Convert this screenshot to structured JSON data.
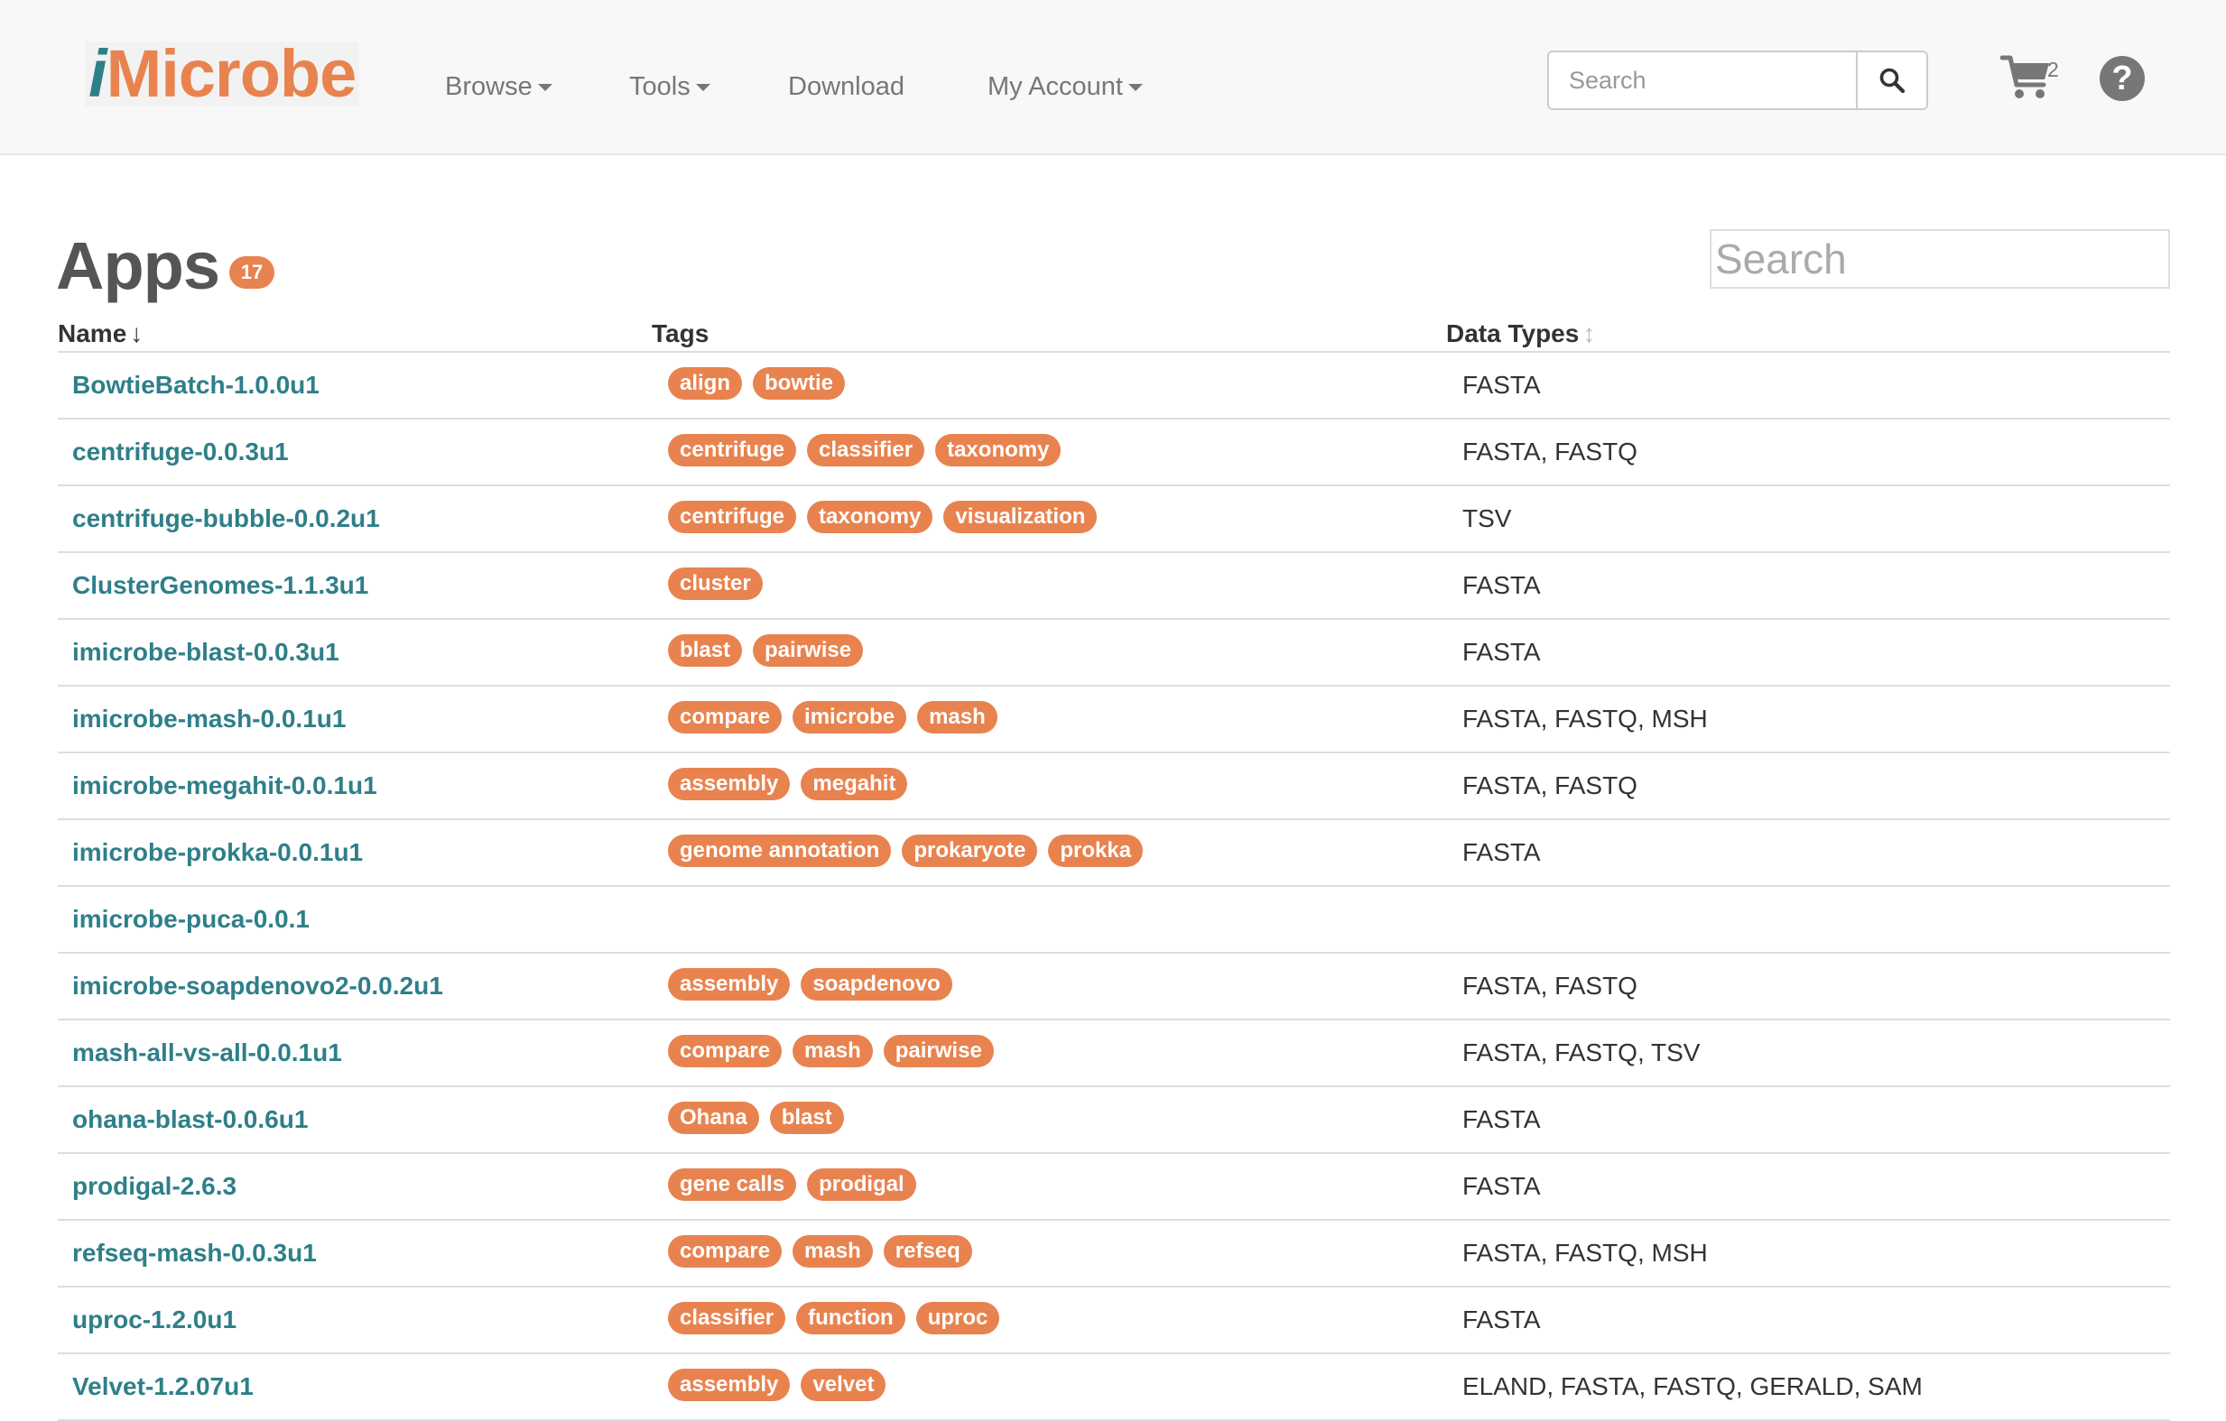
{
  "brand": {
    "logo_prefix": "i",
    "logo_rest": "Microbe"
  },
  "nav": {
    "browse": "Browse",
    "tools": "Tools",
    "download": "Download",
    "my_account": "My Account",
    "search_placeholder": "Search",
    "cart_count": "2",
    "help": "?"
  },
  "page": {
    "title": "Apps",
    "count": "17",
    "search_placeholder": "Search"
  },
  "table": {
    "headers": {
      "name": "Name",
      "tags": "Tags",
      "data_types": "Data Types"
    },
    "name_sort_indicator": "↓",
    "data_types_sort_indicator": "↕",
    "rows": [
      {
        "name": "BowtieBatch-1.0.0u1",
        "tags": [
          "align",
          "bowtie"
        ],
        "data_types": "FASTA"
      },
      {
        "name": "centrifuge-0.0.3u1",
        "tags": [
          "centrifuge",
          "classifier",
          "taxonomy"
        ],
        "data_types": "FASTA, FASTQ"
      },
      {
        "name": "centrifuge-bubble-0.0.2u1",
        "tags": [
          "centrifuge",
          "taxonomy",
          "visualization"
        ],
        "data_types": "TSV"
      },
      {
        "name": "ClusterGenomes-1.1.3u1",
        "tags": [
          "cluster"
        ],
        "data_types": "FASTA"
      },
      {
        "name": "imicrobe-blast-0.0.3u1",
        "tags": [
          "blast",
          "pairwise"
        ],
        "data_types": "FASTA"
      },
      {
        "name": "imicrobe-mash-0.0.1u1",
        "tags": [
          "compare",
          "imicrobe",
          "mash"
        ],
        "data_types": "FASTA, FASTQ, MSH"
      },
      {
        "name": "imicrobe-megahit-0.0.1u1",
        "tags": [
          "assembly",
          "megahit"
        ],
        "data_types": "FASTA, FASTQ"
      },
      {
        "name": "imicrobe-prokka-0.0.1u1",
        "tags": [
          "genome annotation",
          "prokaryote",
          "prokka"
        ],
        "data_types": "FASTA"
      },
      {
        "name": "imicrobe-puca-0.0.1",
        "tags": [],
        "data_types": ""
      },
      {
        "name": "imicrobe-soapdenovo2-0.0.2u1",
        "tags": [
          "assembly",
          "soapdenovo"
        ],
        "data_types": "FASTA, FASTQ"
      },
      {
        "name": "mash-all-vs-all-0.0.1u1",
        "tags": [
          "compare",
          "mash",
          "pairwise"
        ],
        "data_types": "FASTA, FASTQ, TSV"
      },
      {
        "name": "ohana-blast-0.0.6u1",
        "tags": [
          "Ohana",
          "blast"
        ],
        "data_types": "FASTA"
      },
      {
        "name": "prodigal-2.6.3",
        "tags": [
          "gene calls",
          "prodigal"
        ],
        "data_types": "FASTA"
      },
      {
        "name": "refseq-mash-0.0.3u1",
        "tags": [
          "compare",
          "mash",
          "refseq"
        ],
        "data_types": "FASTA, FASTQ, MSH"
      },
      {
        "name": "uproc-1.2.0u1",
        "tags": [
          "classifier",
          "function",
          "uproc"
        ],
        "data_types": "FASTA"
      },
      {
        "name": "Velvet-1.2.07u1",
        "tags": [
          "assembly",
          "velvet"
        ],
        "data_types": "ELAND, FASTA, FASTQ, GERALD, SAM"
      }
    ]
  },
  "icons": {
    "search": "search-icon",
    "cart": "cart-icon",
    "help": "help-icon"
  },
  "colors": {
    "accent": "#e8834f",
    "link": "#2e7f88",
    "navbar_bg": "#f8f8f8"
  }
}
